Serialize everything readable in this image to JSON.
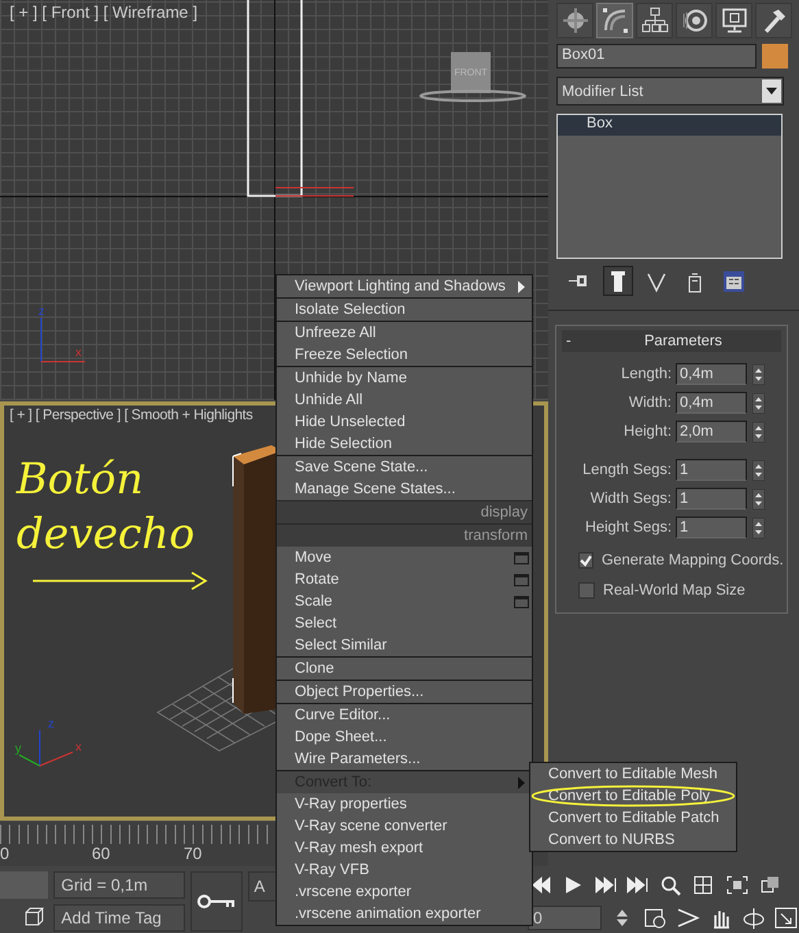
{
  "viewports": [
    {
      "kind": "front",
      "label": "[ + ] [ Front ] [ Wireframe ]",
      "active": false,
      "viewcube": "FRONT",
      "axes": [
        "z",
        "x"
      ]
    },
    {
      "kind": "perspective",
      "label": "[ + ] [ Perspective ] [ Smooth + Highlights",
      "active": true,
      "axes": [
        "z",
        "y",
        "x"
      ],
      "annotation": [
        "Botón",
        "devecho"
      ]
    }
  ],
  "timeline": {
    "labels": [
      "0",
      "60",
      "70"
    ]
  },
  "command_panel": {
    "tabs": [
      {
        "kind": "create",
        "selected": false
      },
      {
        "kind": "modify",
        "selected": true
      },
      {
        "kind": "hierarchy",
        "selected": false
      },
      {
        "kind": "motion",
        "selected": false
      },
      {
        "kind": "display",
        "selected": false
      },
      {
        "kind": "utilities",
        "selected": false
      }
    ],
    "object": {
      "name": "Box01",
      "color": "#d48a3e"
    },
    "modifier_list": "Modifier List",
    "stack": [
      {
        "label": "Box",
        "selected": true
      }
    ],
    "stack_tools": [
      {
        "kind": "pin",
        "selected": false
      },
      {
        "kind": "show-end-result",
        "selected": true
      },
      {
        "kind": "make-unique",
        "selected": false
      },
      {
        "kind": "remove",
        "selected": false
      },
      {
        "kind": "configure",
        "selected": false
      }
    ],
    "rollout": {
      "toggle": "-",
      "title": "Parameters",
      "fields": [
        {
          "label": "Length:",
          "value": "0,4m"
        },
        {
          "label": "Width:",
          "value": "0,4m"
        },
        {
          "label": "Height:",
          "value": "2,0m"
        },
        {
          "label": "Length Segs:",
          "value": "1"
        },
        {
          "label": "Width Segs:",
          "value": "1"
        },
        {
          "label": "Height Segs:",
          "value": "1"
        }
      ],
      "checkboxes": [
        {
          "label": "Generate Mapping Coords.",
          "checked": true
        },
        {
          "label": "Real-World Map Size",
          "checked": false
        }
      ]
    }
  },
  "context_menu": {
    "items": [
      {
        "kind": "item",
        "label": "Viewport Lighting and Shadows",
        "submenu": true
      },
      {
        "kind": "separator"
      },
      {
        "kind": "item",
        "label": "Isolate Selection"
      },
      {
        "kind": "separator"
      },
      {
        "kind": "item",
        "label": "Unfreeze All"
      },
      {
        "kind": "item",
        "label": "Freeze Selection"
      },
      {
        "kind": "separator"
      },
      {
        "kind": "item",
        "label": "Unhide by Name"
      },
      {
        "kind": "item",
        "label": "Unhide All"
      },
      {
        "kind": "item",
        "label": "Hide Unselected"
      },
      {
        "kind": "item",
        "label": "Hide Selection"
      },
      {
        "kind": "separator"
      },
      {
        "kind": "item",
        "label": "Save Scene State..."
      },
      {
        "kind": "item",
        "label": "Manage Scene States..."
      },
      {
        "kind": "header",
        "label": "display"
      },
      {
        "kind": "header",
        "label": "transform"
      },
      {
        "kind": "item",
        "label": "Move",
        "option_box": true
      },
      {
        "kind": "item",
        "label": "Rotate",
        "option_box": true
      },
      {
        "kind": "item",
        "label": "Scale",
        "option_box": true
      },
      {
        "kind": "item",
        "label": "Select"
      },
      {
        "kind": "item",
        "label": "Select Similar"
      },
      {
        "kind": "separator"
      },
      {
        "kind": "item",
        "label": "Clone"
      },
      {
        "kind": "separator"
      },
      {
        "kind": "item",
        "label": "Object Properties..."
      },
      {
        "kind": "separator"
      },
      {
        "kind": "item",
        "label": "Curve Editor..."
      },
      {
        "kind": "item",
        "label": "Dope Sheet..."
      },
      {
        "kind": "item",
        "label": "Wire Parameters..."
      },
      {
        "kind": "separator"
      },
      {
        "kind": "item",
        "label": "Convert To:",
        "submenu": true,
        "highlighted": true
      },
      {
        "kind": "item",
        "label": "V-Ray properties"
      },
      {
        "kind": "item",
        "label": "V-Ray scene converter"
      },
      {
        "kind": "item",
        "label": "V-Ray mesh export"
      },
      {
        "kind": "item",
        "label": "V-Ray VFB"
      },
      {
        "kind": "item",
        "label": ".vrscene exporter"
      },
      {
        "kind": "item",
        "label": ".vrscene animation exporter"
      }
    ]
  },
  "submenu": {
    "items": [
      {
        "label": "Convert to Editable Mesh",
        "circled": false
      },
      {
        "label": "Convert to Editable Poly",
        "circled": true
      },
      {
        "label": "Convert to Editable Patch",
        "circled": false
      },
      {
        "label": "Convert to NURBS",
        "circled": false
      }
    ]
  },
  "bottom_bar": {
    "grid": "Grid = 0,1m",
    "time_tag": "Add Time Tag",
    "auto_key": "A",
    "frame": "0"
  }
}
